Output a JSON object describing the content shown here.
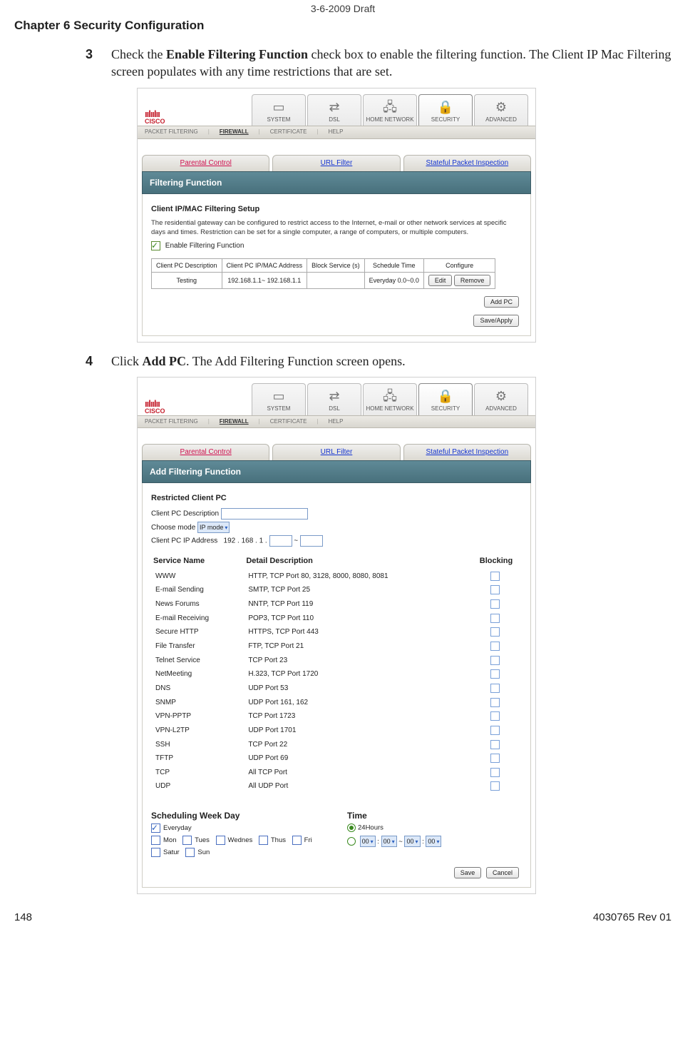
{
  "header": {
    "draft": "3-6-2009 Draft",
    "chapter": "Chapter 6    Security Configuration"
  },
  "steps": {
    "s3num": "3",
    "s3a": "Check the ",
    "s3b": "Enable Filtering Function",
    "s3c": " check box to enable the filtering function. The Client IP Mac Filtering screen populates with any time restrictions that are set.",
    "s4num": "4",
    "s4a": "Click ",
    "s4b": "Add PC",
    "s4c": ". The Add Filtering Function screen opens."
  },
  "nav": {
    "system": "SYSTEM",
    "dsl": "DSL",
    "home": "HOME NETWORK",
    "security": "SECURITY",
    "advanced": "ADVANCED"
  },
  "subnav": {
    "pf": "PACKET FILTERING",
    "fw": "FIREWALL",
    "cert": "CERTIFICATE",
    "help": "HELP"
  },
  "fwtabs": {
    "pc": "Parental Control",
    "url": "URL Filter",
    "spi": "Stateful Packet Inspection"
  },
  "shot1": {
    "panel_title": "Filtering Function",
    "section": "Client IP/MAC Filtering Setup",
    "desc": "The residential gateway can be configured to restrict access to the Internet, e-mail or other network services at specific days and times. Restriction can be set for a single computer, a range of computers, or multiple computers.",
    "enable": "Enable Filtering Function",
    "th": {
      "c1": "Client PC Description",
      "c2": "Client PC IP/MAC Address",
      "c3": "Block Service (s)",
      "c4": "Schedule Time",
      "c5": "Configure"
    },
    "row": {
      "desc": "Testing",
      "ip": "192.168.1.1~ 192.168.1.1",
      "svc": "",
      "sched": "Everyday 0.0~0.0",
      "edit": "Edit",
      "remove": "Remove"
    },
    "add_pc": "Add PC",
    "save": "Save/Apply"
  },
  "shot2": {
    "panel_title": "Add Filtering Function",
    "restricted": "Restricted Client PC",
    "lbl_desc": "Client PC Description",
    "lbl_mode": "Choose mode",
    "mode_val": "IP mode",
    "lbl_ip": "Client PC IP Address",
    "ip_prefix": "192 . 168 . 1 .",
    "ip_tilde": "~",
    "th": {
      "name": "Service Name",
      "detail": "Detail Description",
      "block": "Blocking"
    },
    "rows": [
      {
        "name": "WWW",
        "detail": "HTTP, TCP Port 80, 3128, 8000, 8080, 8081"
      },
      {
        "name": "E-mail Sending",
        "detail": "SMTP, TCP Port 25"
      },
      {
        "name": "News Forums",
        "detail": "NNTP, TCP Port 119"
      },
      {
        "name": "E-mail Receiving",
        "detail": "POP3, TCP Port 110"
      },
      {
        "name": "Secure HTTP",
        "detail": "HTTPS, TCP Port 443"
      },
      {
        "name": "File Transfer",
        "detail": "FTP, TCP Port 21"
      },
      {
        "name": "Telnet Service",
        "detail": "TCP Port 23"
      },
      {
        "name": "NetMeeting",
        "detail": "H.323, TCP Port 1720"
      },
      {
        "name": "DNS",
        "detail": "UDP Port 53"
      },
      {
        "name": "SNMP",
        "detail": "UDP Port 161, 162"
      },
      {
        "name": "VPN-PPTP",
        "detail": "TCP Port 1723"
      },
      {
        "name": "VPN-L2TP",
        "detail": "UDP Port 1701"
      },
      {
        "name": "SSH",
        "detail": "TCP Port 22"
      },
      {
        "name": "TFTP",
        "detail": "UDP Port 69"
      },
      {
        "name": "TCP",
        "detail": "All TCP Port"
      },
      {
        "name": "UDP",
        "detail": "All UDP Port"
      }
    ],
    "sched_hdr": "Scheduling Week Day",
    "time_hdr": "Time",
    "days": {
      "every": "Everyday",
      "mon": "Mon",
      "tue": "Tues",
      "wed": "Wednes",
      "thu": "Thus",
      "fri": "Fri",
      "sat": "Satur",
      "sun": "Sun"
    },
    "t24": "24Hours",
    "tval": "00",
    "save": "Save",
    "cancel": "Cancel"
  },
  "footer": {
    "page": "148",
    "doc": "4030765 Rev 01"
  },
  "logo": {
    "bars": "ıılıılıı",
    "name": "CISCO"
  }
}
